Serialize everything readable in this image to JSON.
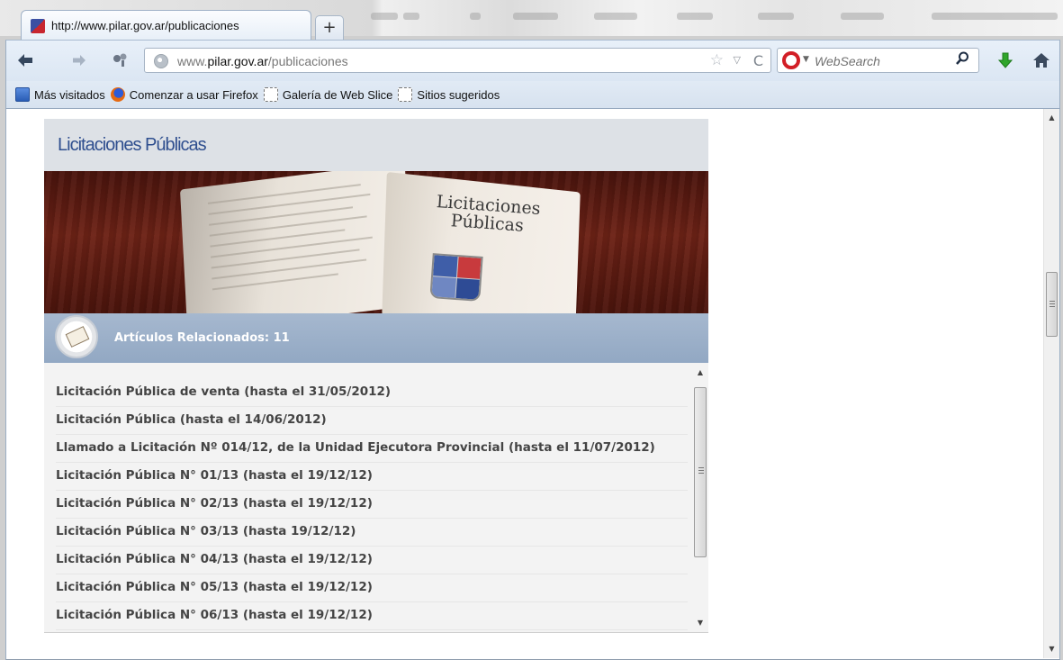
{
  "browser": {
    "tab_title": "http://www.pilar.gov.ar/publicaciones",
    "new_tab_label": "+",
    "url_prefix": "www.",
    "url_domain": "pilar.gov.ar",
    "url_path": "/publicaciones",
    "search_placeholder": "WebSearch",
    "icons": [
      "back-icon",
      "forward-icon",
      "identity-icon",
      "bookmark-star-icon",
      "history-dropdown-icon",
      "reload-icon",
      "search-engine-icon",
      "search-icon",
      "download-icon",
      "home-icon"
    ]
  },
  "bookmarks": [
    {
      "label": "Más visitados",
      "icon": "most-visited-icon"
    },
    {
      "label": "Comenzar a usar Firefox",
      "icon": "firefox-icon"
    },
    {
      "label": "Galería de Web Slice",
      "icon": "web-slice-icon"
    },
    {
      "label": "Sitios sugeridos",
      "icon": "web-slice-icon"
    }
  ],
  "page": {
    "section_title": "Licitaciones Públicas",
    "banner_text_line1": "Licitaciones",
    "banner_text_line2": "Públicas",
    "related_label": "Artículos Relacionados: 11",
    "items": [
      "Licitación Pública de venta (hasta el 31/05/2012)",
      "Licitación Pública (hasta el 14/06/2012)",
      "Llamado a Licitación Nº 014/12, de la Unidad Ejecutora Provincial (hasta el 11/07/2012)",
      "Licitación Pública N° 01/13 (hasta el 19/12/12)",
      "Licitación Pública N° 02/13 (hasta el 19/12/12)",
      "Licitación Pública N° 03/13 (hasta 19/12/12)",
      "Licitación Pública N° 04/13 (hasta el 19/12/12)",
      "Licitación Pública N° 05/13 (hasta el 19/12/12)",
      "Licitación Pública N° 06/13 (hasta el 19/12/12)"
    ]
  },
  "colors": {
    "accent_title": "#2f4f8f",
    "related_bar": "#a6b8cf",
    "search_engine": "#d21e26",
    "download_arrow": "#2fa52b"
  }
}
